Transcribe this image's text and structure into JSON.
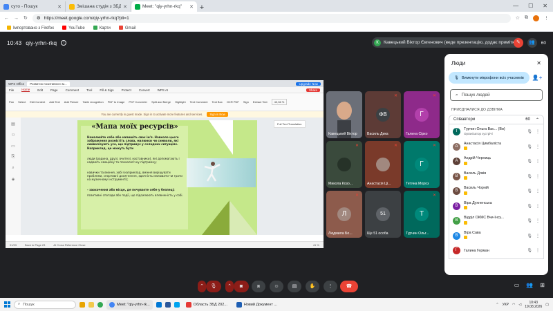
{
  "browser": {
    "tabs": [
      {
        "title": "суто - Пошук",
        "color": "#4285f4"
      },
      {
        "title": "Змішана студія з ЗБД - ...",
        "color": "#fbbc04"
      },
      {
        "title": "Meet: \"qiy-yrhn-rkq\"",
        "color": "#00ac47",
        "active": true
      }
    ],
    "url": "https://meet.google.com/qiy-yrhn-rkq?pli=1",
    "bookmarks": [
      "Імпортовано з Firefox",
      "YouTube",
      "Карти",
      "Gmail"
    ]
  },
  "meet": {
    "time": "10:43",
    "code": "qiy-yrhn-rkq",
    "presenter": "Кавецький Віктор Євгенович (веде презентацію, додає примітки)",
    "presenter_initial": "К",
    "top_count": "60"
  },
  "wps": {
    "app_tab": "WPS Office",
    "doc_tab": "Розвиток позитивного м...",
    "menu": [
      "File",
      "Home",
      "Edit",
      "Page",
      "Comment",
      "Tool",
      "Fill & Sign",
      "Protect",
      "Convert",
      "WPS AI"
    ],
    "active_menu": "Home",
    "tools": [
      "Pan",
      "Select",
      "Edit Content",
      "Add Text",
      "Add Picture",
      "Table recognition",
      "PDF to Image",
      "PDF Converter",
      "Split and Merge",
      "Highlight",
      "Text Comment",
      "Text Box",
      "OCR PDF",
      "Sign",
      "Extract Text",
      "Zoom"
    ],
    "zoom": "40,36 %",
    "note": "You are currently in guest mode. Sign in to activate more features and services.",
    "note_btn": "Sign in Now",
    "float": "Full Text Translation",
    "status": [
      "01/33",
      "Back to Page 23",
      "AI Cross Reference Close",
      "41 %"
    ],
    "upgrade": "Upgrade Now",
    "share": "Share"
  },
  "slide": {
    "title": "«Мапа моїх ресурсів»",
    "p1": "Намалюйте себе або напишіть своє ім'я. Навколо цього зображення розмістіть слова, малюнки чи символи, які символізують усе, що підтримує у складних ситуаціях. Наприклад, це можуть бути",
    "p2": "люди (родина, друзі, вчителі, наставники), які допомагають і надають емоційну та психологічну підтримку;",
    "p3": "навички та вміння, хобі (наприклад, вміння вирішувати проблеми, спортивні досягнення, здатність малювати чи грати на музичному інструменті);",
    "p4": "- заохочення або місце, де почуваєте себе у безпеці;",
    "p5": "позитивні спогади або події, що підсилюють впевненість у собі."
  },
  "tiles": [
    {
      "name": "Кавецький Віктор",
      "bg": "#5b5f66",
      "initial": "",
      "muted": false
    },
    {
      "name": "Василь Дика",
      "bg": "#5d3b36",
      "initial": "ФВ",
      "muted": true
    },
    {
      "name": "Галина Сірко",
      "bg": "#8e2a8a",
      "initial": "Г",
      "muted": true
    },
    {
      "name": "Микола Козо...",
      "bg": "#3a4a3c",
      "initial": "",
      "muted": true
    },
    {
      "name": "Анастасія Ці...",
      "bg": "#7a3a2a",
      "initial": "",
      "muted": true
    },
    {
      "name": "Тетяна Мороз",
      "bg": "#00796b",
      "initial": "Г",
      "muted": true
    },
    {
      "name": "Людмила Бо...",
      "bg": "#8d5b4c",
      "initial": "Л",
      "muted": true
    },
    {
      "name": "Ще 51 особа",
      "bg": "#3c4043",
      "initial": "51",
      "muted": false
    },
    {
      "name": "Турчин Ольг...",
      "bg": "#00695c",
      "initial": "Т",
      "muted": true
    }
  ],
  "people": {
    "title": "Люди",
    "mute_all": "Вимкнути мікрофони всіх учасників",
    "search_placeholder": "Пошук людей",
    "section": "ПРИЄДНАЛИСЯ ДО ДЗВІНКА",
    "group": "Співавтори",
    "group_count": "60",
    "list": [
      {
        "name": "Турчин Ольга Вас... (Ви)",
        "sub": "Організатор зустрічі",
        "initial": "Т",
        "color": "#00695c"
      },
      {
        "name": "Анастасія Цимбаліста",
        "sub": "",
        "initial": "А",
        "color": "#8d6e63"
      },
      {
        "name": "Андрій Черниць",
        "sub": "",
        "initial": "А",
        "color": "#5d4037"
      },
      {
        "name": "Василь Дяків",
        "sub": "",
        "initial": "В",
        "color": "#795548"
      },
      {
        "name": "Василь Чорній",
        "sub": "",
        "initial": "В",
        "color": "#6d4c41"
      },
      {
        "name": "Віра Духненська",
        "sub": "",
        "initial": "В",
        "color": "#7b1fa2"
      },
      {
        "name": "Відділ ОКМС Вчи-Інсу...",
        "sub": "",
        "initial": "В",
        "color": "#43a047"
      },
      {
        "name": "Віра Сава",
        "sub": "",
        "initial": "В",
        "color": "#1e88e5"
      },
      {
        "name": "Галина Герман",
        "sub": "",
        "initial": "Г",
        "color": "#c62828"
      }
    ]
  },
  "controls": {
    "count": "60"
  },
  "taskbar": {
    "search": "Пошук",
    "apps": [
      "Meet: \"qiy-yrhn-rk...",
      "Область ЗБД 202...",
      "Новий Документ ..."
    ],
    "lang": "УКР",
    "time": "10:43",
    "date": "19.08.2026"
  }
}
